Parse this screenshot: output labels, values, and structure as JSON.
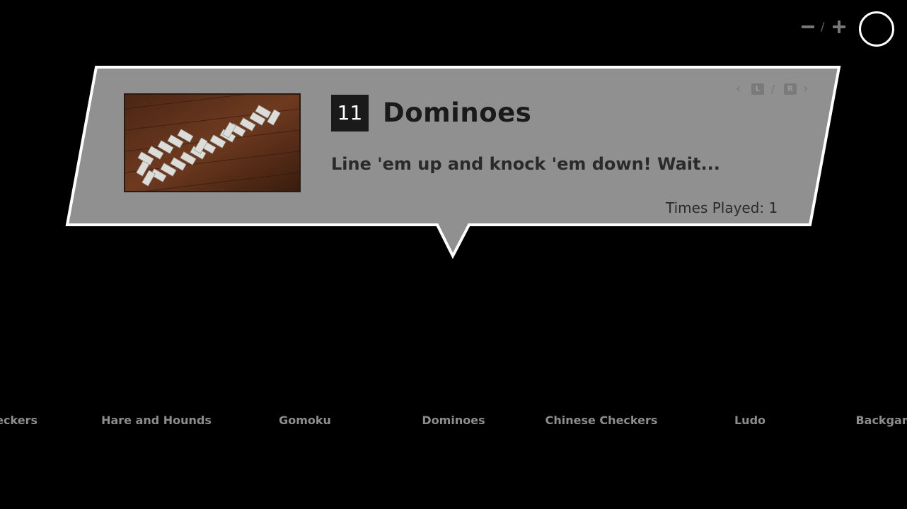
{
  "header": {
    "zoom_separator": "/",
    "zoom_out_icon": "minus-icon",
    "zoom_in_icon": "plus-icon",
    "confirm_icon": "circle-button-icon"
  },
  "game_card": {
    "number": "11",
    "title": "Dominoes",
    "description": "Line 'em up and knock 'em down! Wait...",
    "times_played": "Times Played: 1",
    "nav": {
      "prev_icon": "chevron-left-icon",
      "left_key": "L",
      "separator": "/",
      "right_key": "R",
      "next_icon": "chevron-right-icon"
    }
  },
  "carousel": {
    "items": [
      "Checkers",
      "Hare and Hounds",
      "Gomoku",
      "Dominoes",
      "Chinese Checkers",
      "Ludo",
      "Backgammon"
    ],
    "selected": "Dominoes"
  },
  "colors": {
    "background": "#000000",
    "card": "#909090",
    "card_border": "#ffffff",
    "carousel_text": "#8d8d8d"
  }
}
